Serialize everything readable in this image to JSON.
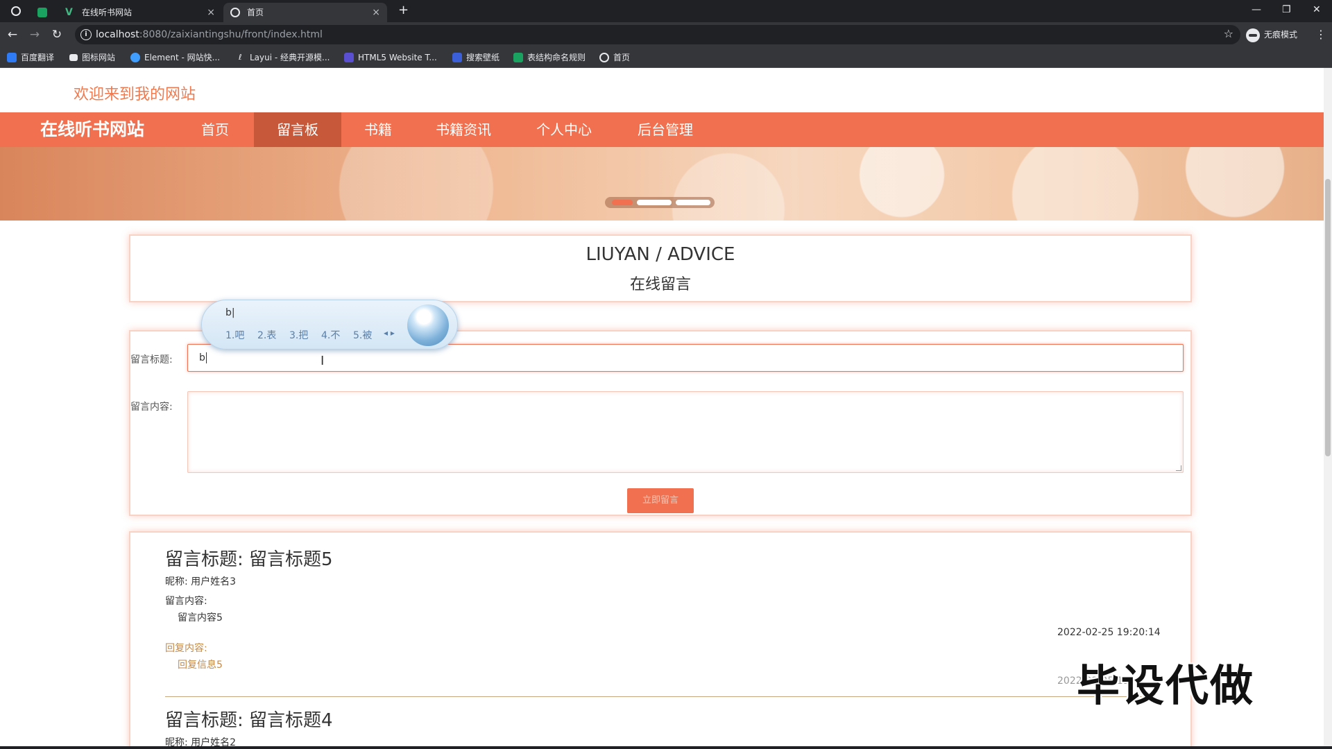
{
  "browser": {
    "tabs": [
      {
        "title": "",
        "icon": "sheet-icon"
      },
      {
        "title": "在线听书网站",
        "icon": "vue-logo-icon",
        "close": "×"
      },
      {
        "title": "首页",
        "icon": "globe-icon",
        "close": "×",
        "active": true
      }
    ],
    "new_tab": "+",
    "window_controls": [
      "—",
      "❐",
      "✕"
    ],
    "nav": {
      "back": "←",
      "forward": "→",
      "reload": "↻"
    },
    "url_host": "localhost",
    "url_rest": ":8080/zaixiantingshu/front/index.html",
    "star": "☆",
    "incognito_label": "无痕模式",
    "menu": "⋮",
    "bookmarks": [
      {
        "label": "百度翻译",
        "color": "#2f7bf5"
      },
      {
        "label": "图标网站",
        "color": "#e8eaed"
      },
      {
        "label": "Element - 网站快...",
        "color": "#409eff"
      },
      {
        "label": "Layui - 经典开源模...",
        "color": "#e8eaed"
      },
      {
        "label": "HTML5 Website T...",
        "color": "#5b4fd1"
      },
      {
        "label": "搜索壁纸",
        "color": "#3b5fd9"
      },
      {
        "label": "表结构命名规则",
        "color": "#1aa260"
      },
      {
        "label": "首页",
        "color": "#e8eaed"
      }
    ]
  },
  "site": {
    "welcome": "欢迎来到我的网站",
    "brand": "在线听书网站",
    "nav": [
      "首页",
      "留言板",
      "书籍",
      "书籍资讯",
      "个人中心",
      "后台管理"
    ],
    "active_nav_index": 1,
    "accent_color": "#f0704f"
  },
  "section": {
    "title_en": "LIUYAN / ADVICE",
    "title_cn": "在线留言"
  },
  "form": {
    "title_label": "留言标题:",
    "title_value": "b",
    "content_label": "留言内容:",
    "submit_label": "立即留言"
  },
  "ime": {
    "composition": "b|",
    "candidates": [
      "1.吧",
      "2.表",
      "3.把",
      "4.不",
      "5.被"
    ],
    "arrows": "◂ ▸"
  },
  "messages": [
    {
      "title": "留言标题: 留言标题5",
      "nickname": "昵称: 用户姓名3",
      "content_label": "留言内容:",
      "content": "留言内容5",
      "time": "2022-02-25 19:20:14",
      "reply_label": "回复内容:",
      "reply": "回复信息5",
      "reply_time": "2022-02-25 19"
    },
    {
      "title": "留言标题: 留言标题4",
      "nickname": "昵称: 用户姓名2"
    }
  ],
  "watermark": "毕设代做"
}
